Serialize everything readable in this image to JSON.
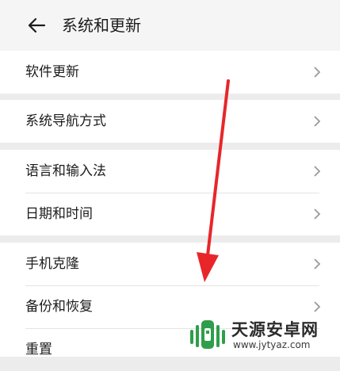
{
  "header": {
    "title": "系统和更新",
    "back_icon": "arrow-left-icon"
  },
  "groups": [
    {
      "items": [
        {
          "label": "软件更新"
        }
      ]
    },
    {
      "items": [
        {
          "label": "系统导航方式"
        }
      ]
    },
    {
      "items": [
        {
          "label": "语言和输入法"
        },
        {
          "label": "日期和时间"
        }
      ]
    },
    {
      "items": [
        {
          "label": "手机克隆"
        },
        {
          "label": "备份和恢复"
        },
        {
          "label": "重置"
        }
      ]
    }
  ],
  "watermark": {
    "brand": "天源安卓网",
    "url": "www.jytyaz.com"
  },
  "colors": {
    "annotation_arrow": "#e8262a",
    "background": "#ececec",
    "card": "#ffffff",
    "chevron": "#9a9a9a",
    "logo_green": "#2e9e4a"
  }
}
